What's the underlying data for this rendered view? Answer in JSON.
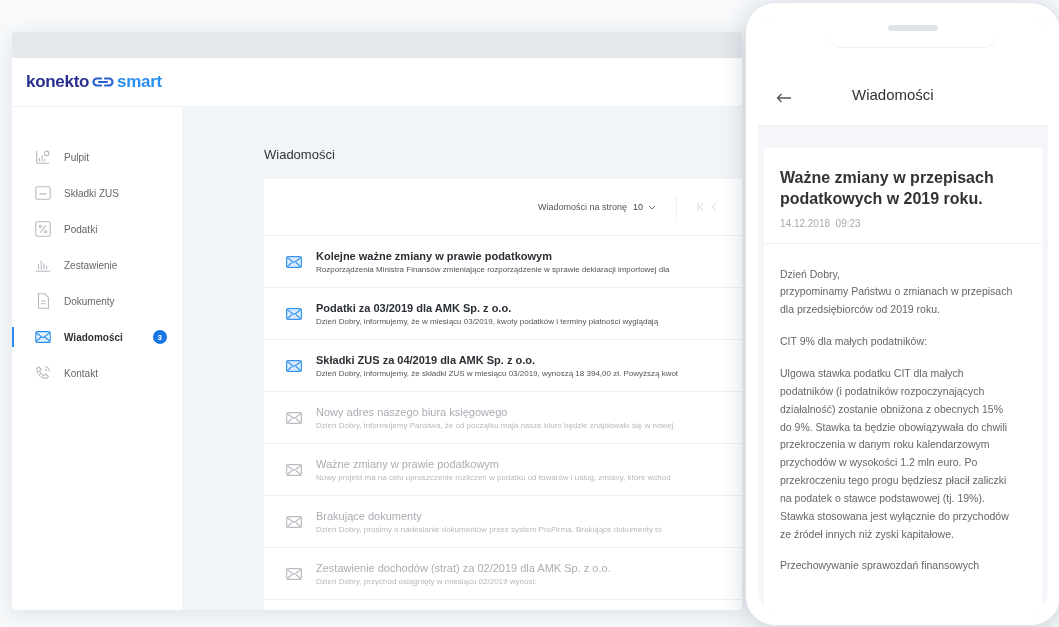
{
  "logo": {
    "first": "konekto",
    "second": "smart"
  },
  "sidebar": {
    "items": [
      {
        "label": "Pulpit",
        "selected": false
      },
      {
        "label": "Składki ZUS",
        "selected": false
      },
      {
        "label": "Podatki",
        "selected": false
      },
      {
        "label": "Zestawienie",
        "selected": false
      },
      {
        "label": "Dokumenty",
        "selected": false
      },
      {
        "label": "Wiadomości",
        "selected": true,
        "badge": "3"
      },
      {
        "label": "Kontakt",
        "selected": false
      }
    ]
  },
  "page_title": "Wiadomości",
  "pager": {
    "label": "Wiadomości na stronę",
    "value": "10"
  },
  "messages": [
    {
      "title": "Kolejne ważne zmiany w prawie podatkowym",
      "preview": "Rozporządzenia Ministra Finansów zmieniające rozporządzenie w sprawie deklaracji importowej dla",
      "unread": true
    },
    {
      "title": "Podatki za 03/2019 dla AMK Sp. z o.o.",
      "preview": "Dzień Dobry, informujemy, że w miesiącu 03/2019, kwoty podatków i terminy płatności wyglądają",
      "unread": true
    },
    {
      "title": "Składki ZUS za 04/2019 dla AMK Sp. z o.o.",
      "preview": "Dzień Dobry, informujemy, że składki ZUS w miesiącu 03/2019, wynoszą 18 394,00 zł. Powyższą kwot",
      "unread": true
    },
    {
      "title": "Nowy adres naszego biura księgowego",
      "preview": "Dzień Dobry, informujemy Państwa, że od początku maja nasze biuro będzie znajdowało się w nowej",
      "unread": false
    },
    {
      "title": "Ważne zmiany w prawie podatkowym",
      "preview": "Nowy projekt ma na celu uproszczenie rozliczeń w podatku od towarów i usług, zmiany, które wchod",
      "unread": false
    },
    {
      "title": "Brakujące dokumenty",
      "preview": "Dzień Dobry, prosimy o nadesłanie dokumentów przez system ProFirma. Brakujące dokumenty to",
      "unread": false
    },
    {
      "title": "Zestawienie dochodów (strat) za 02/2019 dla AMK Sp. z o.o.",
      "preview": "Dzień Dobry, przychód osiągnięty w miesiącu 02/2019 wynosi:",
      "unread": false
    }
  ],
  "phone": {
    "title": "Wiadomości",
    "message_title": "Ważne zmiany w przepisach podatkowych w 2019 roku.",
    "date": "14.12.2018  09:23",
    "paragraphs": [
      "Dzień Dobry,\nprzypominamy Państwu o zmianach w przepisach dla przedsiębiorców od 2019 roku.",
      "CIT 9% dla małych podatników:",
      "Ulgowa stawka podatku CIT dla małych podatników (i podatników rozpoczynających działalność) zostanie obniżona z obecnych 15% do 9%. Stawka ta będzie obowiązywała do chwili przekroczenia w danym roku kalendarzowym przychodów w wysokości 1.2 mln euro. Po przekroczeniu tego progu będziesz płacił zaliczki na podatek o stawce podstawowej (tj. 19%). Stawka stosowana jest wyłącznie do przychodów ze źródeł innych niż zyski kapitałowe.",
      "Przechowywanie sprawozdań finansowych"
    ]
  }
}
